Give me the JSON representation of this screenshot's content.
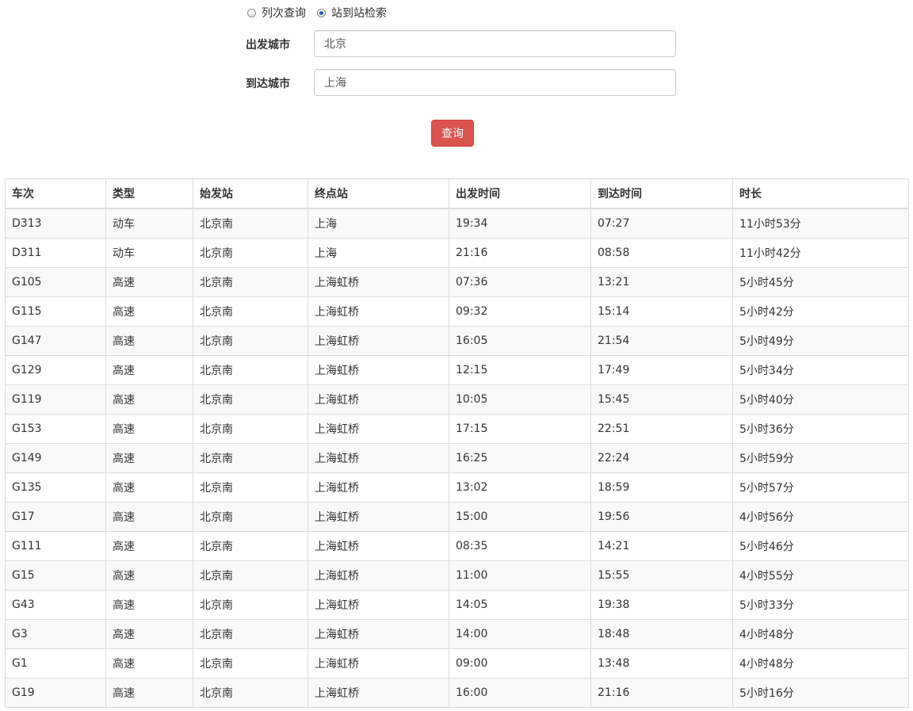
{
  "search": {
    "mode_options": [
      {
        "label": "列次查询",
        "checked": false
      },
      {
        "label": "站到站检索",
        "checked": true
      }
    ],
    "departure_label": "出发城市",
    "departure_value": "北京",
    "arrival_label": "到达城市",
    "arrival_value": "上海",
    "query_button": "查询"
  },
  "table": {
    "headers": [
      "车次",
      "类型",
      "始发站",
      "终点站",
      "出发时间",
      "到达时间",
      "时长"
    ],
    "rows": [
      [
        "D313",
        "动车",
        "北京南",
        "上海",
        "19:34",
        "07:27",
        "11小时53分"
      ],
      [
        "D311",
        "动车",
        "北京南",
        "上海",
        "21:16",
        "08:58",
        "11小时42分"
      ],
      [
        "G105",
        "高速",
        "北京南",
        "上海虹桥",
        "07:36",
        "13:21",
        "5小时45分"
      ],
      [
        "G115",
        "高速",
        "北京南",
        "上海虹桥",
        "09:32",
        "15:14",
        "5小时42分"
      ],
      [
        "G147",
        "高速",
        "北京南",
        "上海虹桥",
        "16:05",
        "21:54",
        "5小时49分"
      ],
      [
        "G129",
        "高速",
        "北京南",
        "上海虹桥",
        "12:15",
        "17:49",
        "5小时34分"
      ],
      [
        "G119",
        "高速",
        "北京南",
        "上海虹桥",
        "10:05",
        "15:45",
        "5小时40分"
      ],
      [
        "G153",
        "高速",
        "北京南",
        "上海虹桥",
        "17:15",
        "22:51",
        "5小时36分"
      ],
      [
        "G149",
        "高速",
        "北京南",
        "上海虹桥",
        "16:25",
        "22:24",
        "5小时59分"
      ],
      [
        "G135",
        "高速",
        "北京南",
        "上海虹桥",
        "13:02",
        "18:59",
        "5小时57分"
      ],
      [
        "G17",
        "高速",
        "北京南",
        "上海虹桥",
        "15:00",
        "19:56",
        "4小时56分"
      ],
      [
        "G111",
        "高速",
        "北京南",
        "上海虹桥",
        "08:35",
        "14:21",
        "5小时46分"
      ],
      [
        "G15",
        "高速",
        "北京南",
        "上海虹桥",
        "11:00",
        "15:55",
        "4小时55分"
      ],
      [
        "G43",
        "高速",
        "北京南",
        "上海虹桥",
        "14:05",
        "19:38",
        "5小时33分"
      ],
      [
        "G3",
        "高速",
        "北京南",
        "上海虹桥",
        "14:00",
        "18:48",
        "4小时48分"
      ],
      [
        "G1",
        "高速",
        "北京南",
        "上海虹桥",
        "09:00",
        "13:48",
        "4小时48分"
      ],
      [
        "G19",
        "高速",
        "北京南",
        "上海虹桥",
        "16:00",
        "21:16",
        "5小时16分"
      ]
    ]
  },
  "colors": {
    "query_button": "#d9534f",
    "row_stripe": "#f9f9f9",
    "border": "#dddddd"
  }
}
